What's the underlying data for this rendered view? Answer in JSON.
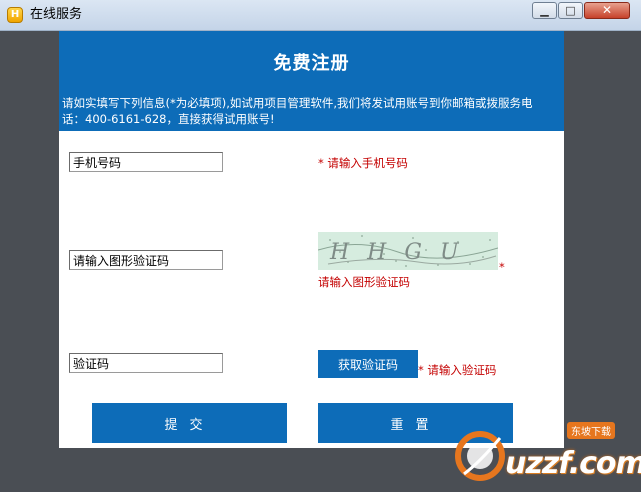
{
  "window": {
    "title": "在线服务",
    "icon": "app-icon",
    "buttons": {
      "minimize": "▁",
      "maximize": "□",
      "close": "✕"
    }
  },
  "header": {
    "title": "免费注册",
    "description": "请如实填写下列信息(*为必填项),如试用项目管理软件,我们将发试用账号到你邮箱或拨服务电话：400-6161-628，直接获得试用账号!"
  },
  "form": {
    "phone": {
      "value": "手机号码",
      "hint": "* 请输入手机号码"
    },
    "captcha": {
      "value": "请输入图形验证码",
      "hint": "请输入图形验证码",
      "star": "*",
      "image_text": "HHGU"
    },
    "sms_code": {
      "value": "验证码",
      "button": "获取验证码",
      "hint": "* 请输入验证码"
    }
  },
  "actions": {
    "submit": "提交",
    "reset": "重置"
  },
  "watermark": {
    "text": "uzzf.com",
    "badge": "东坡下载"
  },
  "colors": {
    "primary": "#0d6cb8",
    "hint": "#c40000",
    "background": "#4a4e54"
  }
}
